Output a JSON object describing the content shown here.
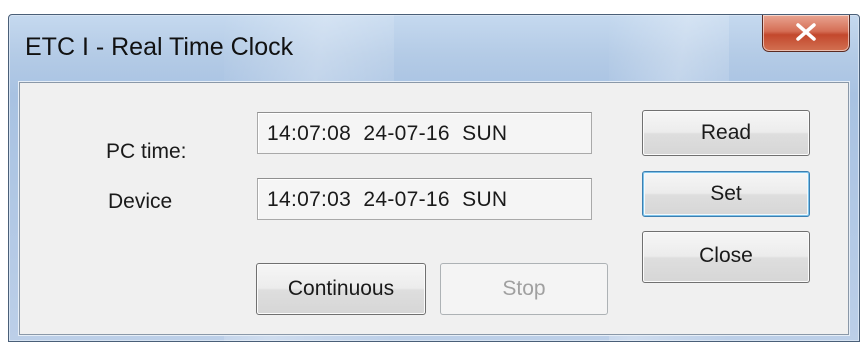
{
  "window": {
    "title": "ETC I - Real Time Clock",
    "close_icon": "close-x-icon"
  },
  "rows": {
    "pc_time": {
      "label": "PC time:",
      "value": "14:07:08  24-07-16  SUN"
    },
    "device": {
      "label": "Device",
      "value": "14:07:03  24-07-16  SUN"
    }
  },
  "buttons": {
    "read": "Read",
    "set": "Set",
    "close": "Close",
    "continuous": "Continuous",
    "stop": "Stop"
  },
  "colors": {
    "title_gradient_top": "#c5d9ef",
    "close_button_red": "#c3482d",
    "client_background": "#f0f0f0",
    "default_button_border": "#3c7fb1",
    "disabled_text": "#a0a0a0"
  }
}
